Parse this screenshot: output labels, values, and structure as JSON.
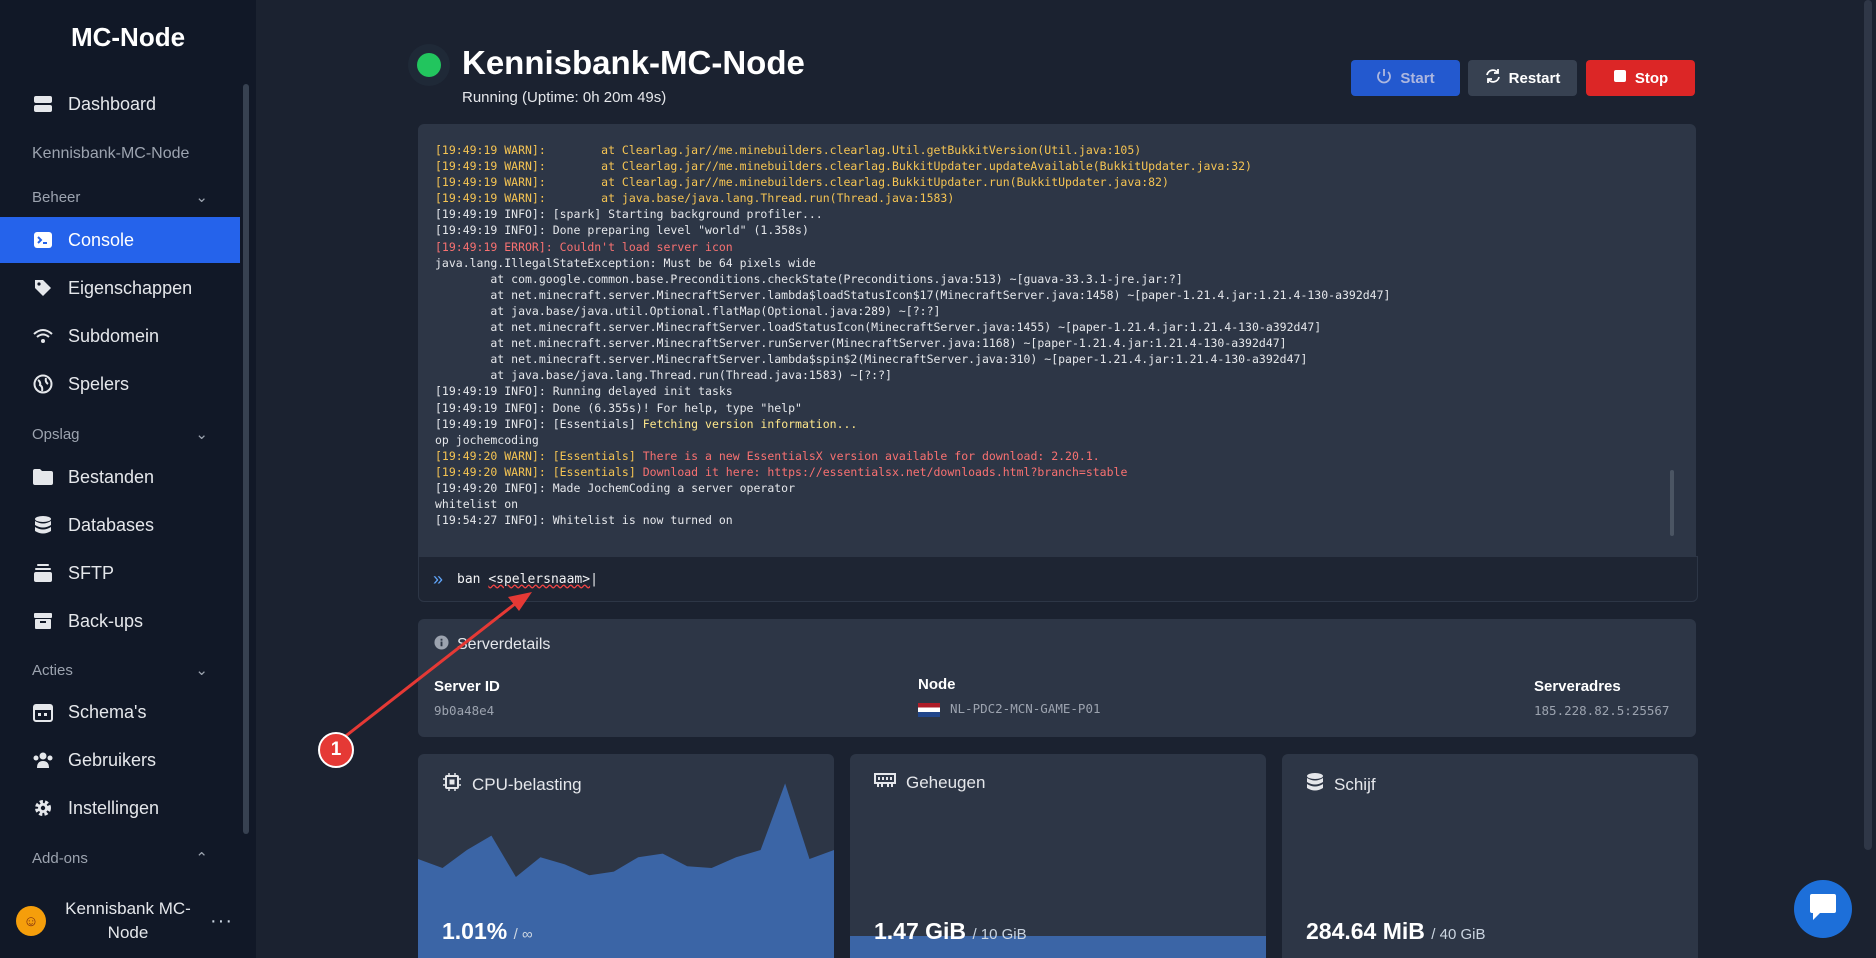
{
  "brand": "MC-Node",
  "nav": {
    "dashboard": "Dashboard",
    "server_label": "Kennisbank-MC-Node",
    "section_beheer": "Beheer",
    "console": "Console",
    "eigenschappen": "Eigenschappen",
    "subdomein": "Subdomein",
    "spelers": "Spelers",
    "section_opslag": "Opslag",
    "bestanden": "Bestanden",
    "databases": "Databases",
    "sftp": "SFTP",
    "backups": "Back-ups",
    "section_acties": "Acties",
    "schemas": "Schema's",
    "gebruikers": "Gebruikers",
    "instellingen": "Instellingen",
    "section_addons": "Add-ons"
  },
  "user": {
    "name": "Kennisbank MC-Node"
  },
  "header": {
    "title": "Kennisbank-MC-Node",
    "status": "Running (Uptime: 0h 20m 49s)",
    "start": "Start",
    "restart": "Restart",
    "stop": "Stop"
  },
  "console": {
    "lines": [
      {
        "t": "[19:49:19 WARN]:        at Clearlag.jar//me.minebuilders.clearlag.Util.getBukkitVersion(Util.java:105)",
        "c": "w"
      },
      {
        "t": "[19:49:19 WARN]:        at Clearlag.jar//me.minebuilders.clearlag.BukkitUpdater.updateAvailable(BukkitUpdater.java:32)",
        "c": "w"
      },
      {
        "t": "[19:49:19 WARN]:        at Clearlag.jar//me.minebuilders.clearlag.BukkitUpdater.run(BukkitUpdater.java:82)",
        "c": "w"
      },
      {
        "t": "[19:49:19 WARN]:        at java.base/java.lang.Thread.run(Thread.java:1583)",
        "c": "w"
      },
      {
        "t": "[19:49:19 INFO]: [spark] Starting background profiler...",
        "c": ""
      },
      {
        "t": "[19:49:19 INFO]: Done preparing level \"world\" (1.358s)",
        "c": ""
      },
      {
        "t": "[19:49:19 ERROR]: Couldn't load server icon",
        "c": "e"
      },
      {
        "t": "java.lang.IllegalStateException: Must be 64 pixels wide",
        "c": ""
      },
      {
        "t": "        at com.google.common.base.Preconditions.checkState(Preconditions.java:513) ~[guava-33.3.1-jre.jar:?]",
        "c": ""
      },
      {
        "t": "        at net.minecraft.server.MinecraftServer.lambda$loadStatusIcon$17(MinecraftServer.java:1458) ~[paper-1.21.4.jar:1.21.4-130-a392d47]",
        "c": ""
      },
      {
        "t": "        at java.base/java.util.Optional.flatMap(Optional.java:289) ~[?:?]",
        "c": ""
      },
      {
        "t": "        at net.minecraft.server.MinecraftServer.loadStatusIcon(MinecraftServer.java:1455) ~[paper-1.21.4.jar:1.21.4-130-a392d47]",
        "c": ""
      },
      {
        "t": "        at net.minecraft.server.MinecraftServer.runServer(MinecraftServer.java:1168) ~[paper-1.21.4.jar:1.21.4-130-a392d47]",
        "c": ""
      },
      {
        "t": "        at net.minecraft.server.MinecraftServer.lambda$spin$2(MinecraftServer.java:310) ~[paper-1.21.4.jar:1.21.4-130-a392d47]",
        "c": ""
      },
      {
        "t": "        at java.base/java.lang.Thread.run(Thread.java:1583) ~[?:?]",
        "c": ""
      },
      {
        "t": "[19:49:19 INFO]: Running delayed init tasks",
        "c": ""
      },
      {
        "t": "[19:49:19 INFO]: Done (6.355s)! For help, type \"help\"",
        "c": ""
      },
      {
        "t": "[19:49:19 INFO]: [Essentials] Fetching version information...",
        "c": "info-y"
      },
      {
        "t": "op jochemcoding",
        "c": ""
      },
      {
        "t": "[19:49:20 WARN]: [Essentials] There is a new EssentialsX version available for download: 2.20.1.",
        "c": "ew"
      },
      {
        "t": "[19:49:20 WARN]: [Essentials] Download it here: https://essentialsx.net/downloads.html?branch=stable",
        "c": "ew"
      },
      {
        "t": "[19:49:20 INFO]: Made JochemCoding a server operator",
        "c": ""
      },
      {
        "t": "whitelist on",
        "c": ""
      },
      {
        "t": "[19:54:27 INFO]: Whitelist is now turned on",
        "c": ""
      }
    ],
    "input_cmd": "ban ",
    "input_arg": "<spelersnaam>"
  },
  "details": {
    "title": "Serverdetails",
    "server_id_label": "Server ID",
    "server_id": "9b0a48e4",
    "node_label": "Node",
    "node": "NL-PDC2-MCN-GAME-P01",
    "address_label": "Serveradres",
    "address": "185.228.82.5:25567"
  },
  "stats": {
    "cpu_label": "CPU-belasting",
    "cpu_value": "1.01%",
    "cpu_limit": "/ ∞",
    "cpu_history": [
      0.55,
      0.5,
      0.6,
      0.68,
      0.45,
      0.56,
      0.52,
      0.46,
      0.48,
      0.56,
      0.58,
      0.51,
      0.5,
      0.56,
      0.6,
      0.97,
      0.55,
      0.6
    ],
    "mem_label": "Geheugen",
    "mem_value": "1.47 GiB",
    "mem_limit": "/ 10 GiB",
    "mem_fraction": 0.147,
    "disk_label": "Schijf",
    "disk_value": "284.64 MiB",
    "disk_limit": "/ 40 GiB"
  },
  "annotation": {
    "number": "1"
  },
  "colors": {
    "accent": "#2563eb",
    "stop": "#dc2626",
    "status": "#22c55e",
    "warn": "#f5c453",
    "error": "#f87171"
  }
}
